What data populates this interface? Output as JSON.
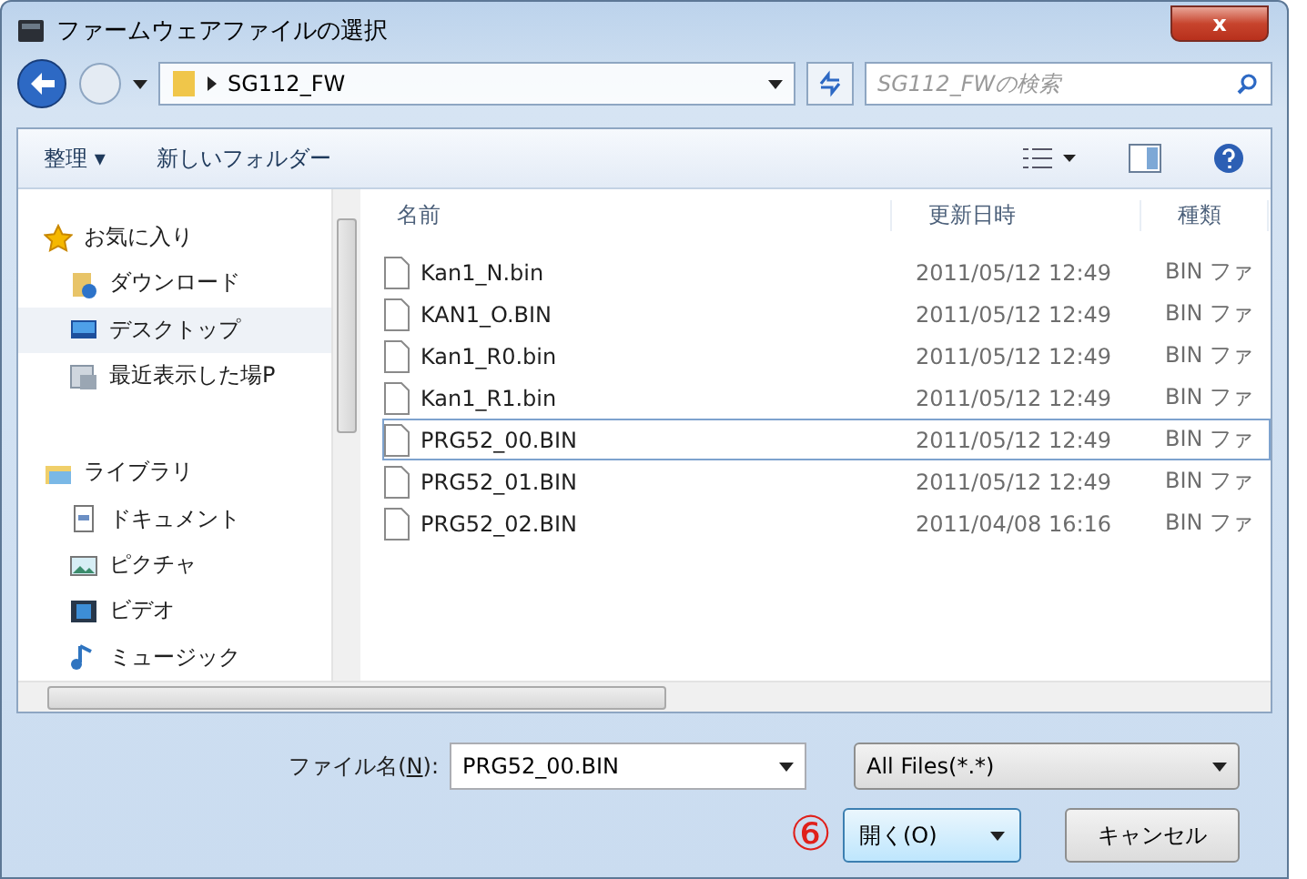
{
  "window": {
    "title": "ファームウェアファイルの選択",
    "close": "x"
  },
  "address": {
    "path": "SG112_FW",
    "search_placeholder": "SG112_FWの検索"
  },
  "toolbar": {
    "organize": "整理 ▾",
    "new_folder": "新しいフォルダー"
  },
  "sidebar": {
    "groups": [
      {
        "label": "お気に入り",
        "children": [
          {
            "label": "ダウンロード",
            "selected": false
          },
          {
            "label": "デスクトップ",
            "selected": true
          },
          {
            "label": "最近表示した場P",
            "selected": false
          }
        ]
      },
      {
        "label": "ライブラリ",
        "children": [
          {
            "label": "ドキュメント",
            "selected": false
          },
          {
            "label": "ピクチャ",
            "selected": false
          },
          {
            "label": "ビデオ",
            "selected": false
          },
          {
            "label": "ミュージック",
            "selected": false
          }
        ]
      }
    ]
  },
  "table": {
    "columns": [
      "名前",
      "更新日時",
      "種類"
    ],
    "rows": [
      {
        "name": "Kan1_N.bin",
        "date": "2011/05/12 12:49",
        "type": "BIN ファ",
        "selected": false
      },
      {
        "name": "KAN1_O.BIN",
        "date": "2011/05/12 12:49",
        "type": "BIN ファ",
        "selected": false
      },
      {
        "name": "Kan1_R0.bin",
        "date": "2011/05/12 12:49",
        "type": "BIN ファ",
        "selected": false
      },
      {
        "name": "Kan1_R1.bin",
        "date": "2011/05/12 12:49",
        "type": "BIN ファ",
        "selected": false
      },
      {
        "name": "PRG52_00.BIN",
        "date": "2011/05/12 12:49",
        "type": "BIN ファ",
        "selected": true
      },
      {
        "name": "PRG52_01.BIN",
        "date": "2011/05/12 12:49",
        "type": "BIN ファ",
        "selected": false
      },
      {
        "name": "PRG52_02.BIN",
        "date": "2011/04/08 16:16",
        "type": "BIN ファ",
        "selected": false
      }
    ]
  },
  "footer": {
    "filename_label_before": "ファイル名(",
    "filename_accesskey": "N",
    "filename_label_after": "):",
    "filename_value": "PRG52_00.BIN",
    "filter": "All Files(*.*)",
    "step_marker": "⑥",
    "open": "開く(O)",
    "cancel": "キャンセル"
  }
}
